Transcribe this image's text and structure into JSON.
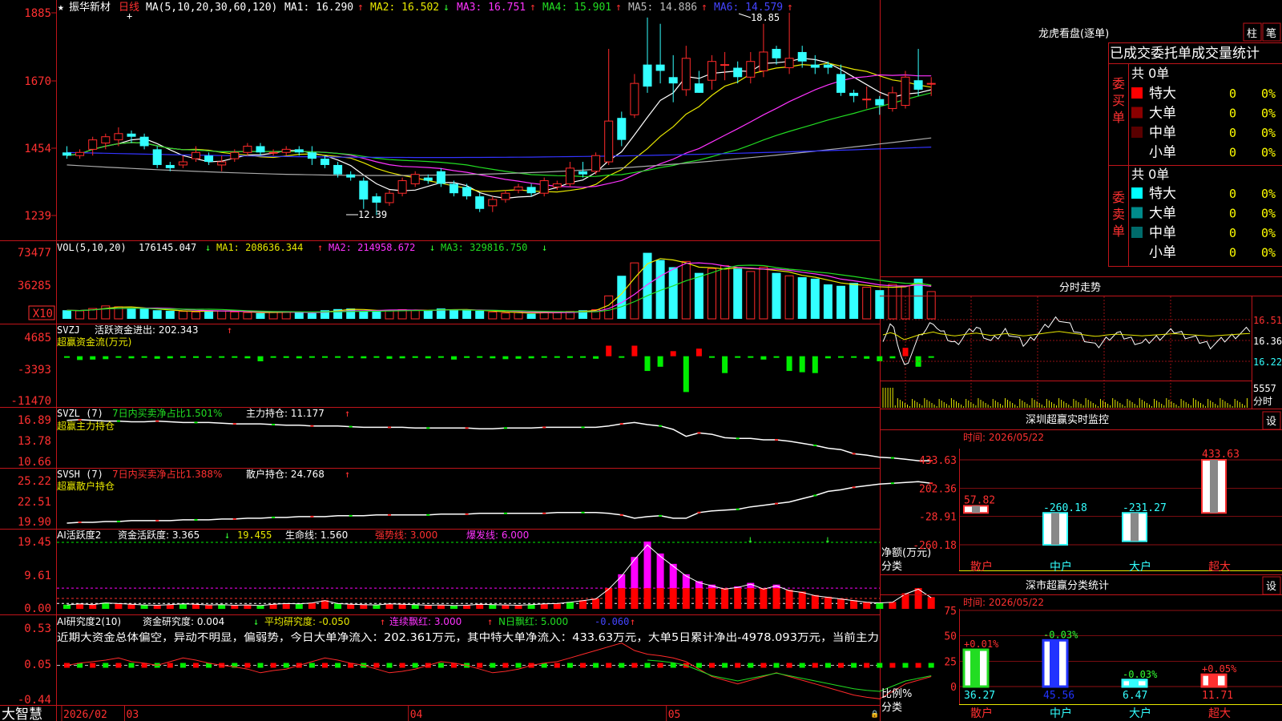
{
  "app": {
    "title": "大智慧",
    "date_label": "2026/02"
  },
  "stock": {
    "name": "振华新材",
    "period": "日线",
    "ma_params": "MA(5,10,20,30,60,120)"
  },
  "colors": {
    "up": "#ff2a2a",
    "down": "#33ffff",
    "bg": "#000000",
    "border": "#c0141a",
    "ma1": "#ffffff",
    "ma2": "#e8e800",
    "ma3": "#ff33ff",
    "ma4": "#22dd22",
    "ma5": "#aaaaaa",
    "ma6": "#3333ff",
    "green_bar": "#00ee00",
    "magenta_bar": "#ff00ff"
  },
  "kline": {
    "axis_labels": [
      "1885",
      "1670",
      "1454",
      "1239"
    ],
    "legend": [
      {
        "text": "MA1: 16.290",
        "arrow": "↑"
      },
      {
        "text": "MA2: 16.502",
        "arrow": "↓"
      },
      {
        "text": "MA3: 16.751",
        "arrow": "↑"
      },
      {
        "text": "MA4: 15.901",
        "arrow": "↑"
      },
      {
        "text": "MA5: 14.886",
        "arrow": "↑"
      },
      {
        "text": "MA6: 14.579",
        "arrow": "↑"
      }
    ],
    "high_label": "18.85",
    "low_label": "12.39",
    "candles": [
      {
        "o": 14.4,
        "h": 14.6,
        "l": 14.2,
        "c": 14.3
      },
      {
        "o": 14.3,
        "h": 14.5,
        "l": 14.2,
        "c": 14.4
      },
      {
        "o": 14.5,
        "h": 14.9,
        "l": 14.3,
        "c": 14.8
      },
      {
        "o": 14.7,
        "h": 15.0,
        "l": 14.5,
        "c": 14.9
      },
      {
        "o": 14.8,
        "h": 15.2,
        "l": 14.6,
        "c": 15.0
      },
      {
        "o": 15.0,
        "h": 15.1,
        "l": 14.7,
        "c": 14.9
      },
      {
        "o": 14.9,
        "h": 15.0,
        "l": 14.5,
        "c": 14.6
      },
      {
        "o": 14.5,
        "h": 14.6,
        "l": 13.9,
        "c": 14.0
      },
      {
        "o": 14.0,
        "h": 14.1,
        "l": 13.8,
        "c": 13.9
      },
      {
        "o": 14.0,
        "h": 14.3,
        "l": 13.9,
        "c": 14.1
      },
      {
        "o": 14.2,
        "h": 14.6,
        "l": 14.1,
        "c": 14.4
      },
      {
        "o": 14.3,
        "h": 14.4,
        "l": 14.0,
        "c": 14.1
      },
      {
        "o": 14.0,
        "h": 14.3,
        "l": 13.8,
        "c": 14.1
      },
      {
        "o": 14.2,
        "h": 14.5,
        "l": 14.1,
        "c": 14.4
      },
      {
        "o": 14.4,
        "h": 14.7,
        "l": 14.3,
        "c": 14.6
      },
      {
        "o": 14.6,
        "h": 14.7,
        "l": 14.3,
        "c": 14.4
      },
      {
        "o": 14.4,
        "h": 14.5,
        "l": 14.3,
        "c": 14.4
      },
      {
        "o": 14.4,
        "h": 14.6,
        "l": 14.3,
        "c": 14.5
      },
      {
        "o": 14.5,
        "h": 14.6,
        "l": 14.3,
        "c": 14.4
      },
      {
        "o": 14.4,
        "h": 14.6,
        "l": 14.0,
        "c": 14.2
      },
      {
        "o": 14.2,
        "h": 14.3,
        "l": 13.9,
        "c": 14.0
      },
      {
        "o": 14.0,
        "h": 14.1,
        "l": 13.6,
        "c": 13.7
      },
      {
        "o": 13.7,
        "h": 13.8,
        "l": 13.5,
        "c": 13.6
      },
      {
        "o": 13.5,
        "h": 13.6,
        "l": 12.6,
        "c": 12.9
      },
      {
        "o": 13.0,
        "h": 13.1,
        "l": 12.4,
        "c": 12.8
      },
      {
        "o": 12.8,
        "h": 13.2,
        "l": 12.7,
        "c": 13.1
      },
      {
        "o": 13.1,
        "h": 13.6,
        "l": 13.0,
        "c": 13.5
      },
      {
        "o": 13.4,
        "h": 13.8,
        "l": 13.3,
        "c": 13.7
      },
      {
        "o": 13.6,
        "h": 13.7,
        "l": 13.4,
        "c": 13.5
      },
      {
        "o": 13.8,
        "h": 13.9,
        "l": 13.3,
        "c": 13.4
      },
      {
        "o": 13.4,
        "h": 13.5,
        "l": 13.0,
        "c": 13.1
      },
      {
        "o": 13.3,
        "h": 13.4,
        "l": 12.9,
        "c": 13.0
      },
      {
        "o": 13.0,
        "h": 13.1,
        "l": 12.5,
        "c": 12.6
      },
      {
        "o": 12.7,
        "h": 13.0,
        "l": 12.5,
        "c": 12.9
      },
      {
        "o": 12.9,
        "h": 13.2,
        "l": 12.8,
        "c": 13.1
      },
      {
        "o": 13.2,
        "h": 13.4,
        "l": 13.1,
        "c": 13.3
      },
      {
        "o": 13.3,
        "h": 13.4,
        "l": 13.0,
        "c": 13.1
      },
      {
        "o": 13.1,
        "h": 13.6,
        "l": 13.0,
        "c": 13.5
      },
      {
        "o": 13.3,
        "h": 13.5,
        "l": 13.2,
        "c": 13.4
      },
      {
        "o": 13.4,
        "h": 14.1,
        "l": 13.3,
        "c": 13.9
      },
      {
        "o": 13.8,
        "h": 14.1,
        "l": 13.6,
        "c": 13.7
      },
      {
        "o": 13.8,
        "h": 14.4,
        "l": 13.7,
        "c": 14.3
      },
      {
        "o": 14.1,
        "h": 17.7,
        "l": 14.0,
        "c": 15.4
      },
      {
        "o": 15.5,
        "h": 15.7,
        "l": 14.6,
        "c": 14.8
      },
      {
        "o": 15.6,
        "h": 16.9,
        "l": 15.5,
        "c": 16.6
      },
      {
        "o": 17.2,
        "h": 18.7,
        "l": 16.3,
        "c": 16.5
      },
      {
        "o": 17.2,
        "h": 18.5,
        "l": 16.6,
        "c": 17.0
      },
      {
        "o": 16.8,
        "h": 17.5,
        "l": 16.0,
        "c": 16.6
      },
      {
        "o": 16.4,
        "h": 17.8,
        "l": 16.2,
        "c": 17.4
      },
      {
        "o": 16.6,
        "h": 17.0,
        "l": 16.3,
        "c": 16.3
      },
      {
        "o": 16.7,
        "h": 17.5,
        "l": 16.4,
        "c": 17.3
      },
      {
        "o": 17.2,
        "h": 17.6,
        "l": 16.7,
        "c": 17.2
      },
      {
        "o": 17.1,
        "h": 17.3,
        "l": 16.6,
        "c": 16.8
      },
      {
        "o": 16.8,
        "h": 17.6,
        "l": 16.6,
        "c": 17.3
      },
      {
        "o": 17.0,
        "h": 18.5,
        "l": 16.8,
        "c": 17.6
      },
      {
        "o": 17.7,
        "h": 17.8,
        "l": 17.2,
        "c": 17.4
      },
      {
        "o": 17.1,
        "h": 18.85,
        "l": 16.9,
        "c": 17.4
      },
      {
        "o": 17.6,
        "h": 17.8,
        "l": 17.1,
        "c": 17.3
      },
      {
        "o": 17.2,
        "h": 17.5,
        "l": 16.9,
        "c": 17.1
      },
      {
        "o": 17.2,
        "h": 17.3,
        "l": 16.9,
        "c": 17.1
      },
      {
        "o": 16.9,
        "h": 17.2,
        "l": 16.2,
        "c": 16.3
      },
      {
        "o": 16.3,
        "h": 16.4,
        "l": 16.0,
        "c": 16.2
      },
      {
        "o": 16.1,
        "h": 16.5,
        "l": 15.8,
        "c": 16.1
      },
      {
        "o": 16.1,
        "h": 16.2,
        "l": 15.6,
        "c": 15.9
      },
      {
        "o": 15.8,
        "h": 16.5,
        "l": 15.7,
        "c": 16.3
      },
      {
        "o": 15.9,
        "h": 17.0,
        "l": 15.8,
        "c": 16.8
      },
      {
        "o": 16.7,
        "h": 17.7,
        "l": 16.2,
        "c": 16.4
      },
      {
        "o": 16.6,
        "h": 16.8,
        "l": 16.2,
        "c": 16.6
      }
    ]
  },
  "vol": {
    "axis_labels": [
      "73477",
      "36285",
      "X10"
    ],
    "legend": [
      {
        "text": "VOL(5,10,20)",
        "value": "176145.047",
        "arrow": "↓"
      },
      {
        "text": "MA1: 208636.344",
        "arrow": "↑"
      },
      {
        "text": "MA2: 214958.672",
        "arrow": "↓"
      },
      {
        "text": "MA3: 329816.750",
        "arrow": "↓"
      }
    ],
    "values": [
      30,
      28,
      36,
      45,
      42,
      38,
      35,
      30,
      28,
      26,
      24,
      30,
      28,
      24,
      22,
      20,
      25,
      24,
      22,
      20,
      30,
      34,
      36,
      28,
      26,
      30,
      32,
      30,
      28,
      36,
      32,
      30,
      28,
      24,
      20,
      22,
      18,
      24,
      22,
      26,
      30,
      32,
      80,
      150,
      195,
      230,
      205,
      180,
      200,
      160,
      175,
      185,
      175,
      165,
      180,
      160,
      150,
      145,
      140,
      120,
      115,
      125,
      110,
      100,
      120,
      115,
      140,
      95
    ]
  },
  "svzj": {
    "title": "SVZJ",
    "legend": "活跃资金进出: 202.343",
    "legend_arrow": "↑",
    "subtitle": "超赢资金流(万元)",
    "axis_labels": [
      "4685",
      "-3393",
      "-11470"
    ],
    "values": [
      -200,
      -900,
      -800,
      -700,
      -300,
      -500,
      -300,
      -600,
      -500,
      -200,
      -400,
      -300,
      -350,
      -300,
      -500,
      -1200,
      -300,
      -400,
      -500,
      -300,
      -350,
      -300,
      -400,
      -500,
      -300,
      -600,
      -500,
      -400,
      -500,
      -300,
      -800,
      -400,
      -300,
      -500,
      -700,
      -600,
      -500,
      -200,
      -300,
      -400,
      -300,
      -600,
      2500,
      -300,
      2500,
      -3500,
      -2500,
      1200,
      -8500,
      1800,
      -300,
      -4000,
      -200,
      -300,
      -800,
      -300,
      -3500,
      -3800,
      -4000,
      -500,
      -300,
      -200,
      -600,
      -1200,
      -500,
      2000,
      -2500,
      -200
    ]
  },
  "svzl": {
    "title": "SVZL (7)",
    "legend": "7日内买卖净占比1.501%",
    "legend2": "主力持仓: 11.177",
    "legend2_arrow": "↑",
    "subtitle": "超赢主力持仓",
    "axis_labels": [
      "16.89",
      "13.78",
      "10.66"
    ],
    "values": [
      16.8,
      16.9,
      16.8,
      16.7,
      16.7,
      16.6,
      16.6,
      16.7,
      16.6,
      16.5,
      16.5,
      16.5,
      16.4,
      16.3,
      16.3,
      16.3,
      16.2,
      16.1,
      16.1,
      16.0,
      16.0,
      16.0,
      15.9,
      15.8,
      15.8,
      15.8,
      15.8,
      15.7,
      15.7,
      15.7,
      15.7,
      15.7,
      15.6,
      15.6,
      15.7,
      15.7,
      15.7,
      15.8,
      15.8,
      15.8,
      15.8,
      15.8,
      16.0,
      16.3,
      16.5,
      16.2,
      16.0,
      15.5,
      14.5,
      15.0,
      14.8,
      14.3,
      14.2,
      14.2,
      14.0,
      14.0,
      13.8,
      13.5,
      13.2,
      12.8,
      12.6,
      12.0,
      11.8,
      11.5,
      11.4,
      11.2,
      11.0,
      11.0
    ]
  },
  "svsh": {
    "title": "SVSH (7)",
    "legend": "7日内买卖净占比1.388%",
    "legend2": "散户持仓: 24.768",
    "legend2_arrow": "↑",
    "subtitle": "超赢散户持仓",
    "axis_labels": [
      "25.22",
      "22.51",
      "19.90"
    ],
    "values": [
      20.0,
      20.1,
      20.1,
      20.2,
      20.2,
      20.3,
      20.3,
      20.3,
      20.3,
      20.4,
      20.4,
      20.4,
      20.5,
      20.5,
      20.6,
      20.6,
      20.7,
      20.7,
      20.8,
      20.8,
      20.8,
      20.9,
      20.9,
      20.9,
      21.0,
      21.0,
      21.0,
      21.0,
      21.0,
      21.1,
      21.1,
      21.1,
      21.2,
      21.2,
      21.2,
      21.2,
      21.2,
      21.2,
      21.3,
      21.3,
      21.3,
      21.3,
      21.2,
      21.0,
      20.6,
      20.8,
      20.9,
      20.6,
      20.6,
      21.3,
      21.5,
      21.6,
      21.7,
      22.0,
      22.2,
      22.4,
      22.6,
      23.0,
      23.4,
      23.9,
      24.1,
      24.4,
      24.6,
      24.8,
      24.9,
      25.0,
      25.1,
      24.9
    ]
  },
  "ai_activity": {
    "title": "AI活跃度2",
    "legend": "资金活跃度: 3.365",
    "legend_arrow": "↓",
    "legend_val2": "19.455",
    "lifeline": "生命线: 1.560",
    "strong": "强势线: 3.000",
    "burst": "爆发线: 6.000",
    "axis_labels": [
      "19.45",
      "9.61",
      "0.00"
    ],
    "values": [
      1.2,
      1.5,
      1.3,
      1.8,
      1.6,
      1.4,
      1.2,
      1.1,
      1.3,
      1.5,
      1.4,
      1.2,
      1.3,
      1.1,
      1.2,
      1.0,
      1.4,
      1.6,
      1.5,
      1.8,
      2.5,
      1.6,
      1.4,
      1.3,
      1.2,
      1.5,
      1.4,
      1.3,
      1.1,
      1.2,
      1.0,
      1.1,
      1.4,
      1.3,
      1.2,
      1.1,
      1.3,
      1.5,
      1.6,
      2.0,
      2.5,
      3.0,
      6.0,
      10.0,
      15.0,
      19.45,
      16.0,
      13.0,
      10.0,
      8.0,
      7.0,
      6.0,
      6.5,
      7.5,
      6.0,
      7.0,
      5.5,
      5.0,
      4.0,
      3.5,
      3.0,
      2.5,
      2.0,
      1.8,
      2.0,
      4.5,
      6.0,
      3.4
    ]
  },
  "ai_research": {
    "title": "AI研究度2(10)",
    "legend": "资金研究度: 0.004",
    "legend_arrow": "↓",
    "avg": "平均研究度: -0.050",
    "avg_arrow": "↑",
    "red": "连续飘红: 3.000",
    "red_arrow": "↑",
    "nred": "N日飘红: 5.000",
    "extra": "-0.060",
    "extra_arrow": "↑",
    "summary": "近期大资金总体偏空，异动不明显，偏弱势，今日大单净流入：202.361万元，其中特大单净流入：433.63万元，大单5日累计净出-4978.093万元，当前主力",
    "axis_labels": [
      "0.53",
      "0.05",
      "-0.44"
    ],
    "values": [
      0.05,
      0.08,
      0.1,
      0.12,
      0.15,
      0.1,
      0.08,
      0.05,
      0.1,
      0.15,
      0.12,
      0.08,
      0.05,
      0.03,
      0.0,
      -0.05,
      -0.02,
      0.0,
      0.05,
      0.1,
      0.15,
      0.12,
      0.08,
      0.05,
      0.0,
      -0.05,
      -0.03,
      0.0,
      0.05,
      0.1,
      0.08,
      0.05,
      0.0,
      -0.05,
      -0.03,
      0.0,
      0.05,
      0.08,
      0.1,
      0.15,
      0.2,
      0.25,
      0.3,
      0.35,
      0.25,
      0.2,
      0.18,
      0.15,
      0.1,
      0.0,
      -0.1,
      -0.15,
      -0.2,
      -0.15,
      -0.1,
      -0.05,
      -0.1,
      -0.15,
      -0.2,
      -0.25,
      -0.3,
      -0.35,
      -0.38,
      -0.4,
      -0.3,
      -0.2,
      -0.15,
      -0.1
    ]
  },
  "xaxis": {
    "labels": [
      "2026/02",
      "03",
      "04",
      "05"
    ],
    "tick_index": [
      0,
      5,
      27,
      47
    ]
  },
  "right": {
    "dragon_title": "龙虎看盘(逐单)",
    "btn_bar": "柱",
    "btn_tick": "笔",
    "dragon_header": "已成交委托单成交量统计",
    "buy_total": "共 0单",
    "sell_total": "共 0单",
    "buy_label": "委买单",
    "sell_label": "委卖单",
    "buy_rows": [
      {
        "name": "特大",
        "count": "0",
        "pct": "0%",
        "color": "#ff0000"
      },
      {
        "name": "大单",
        "count": "0",
        "pct": "0%",
        "color": "#8b0000"
      },
      {
        "name": "中单",
        "count": "0",
        "pct": "0%",
        "color": "#5a0000"
      },
      {
        "name": "小单",
        "count": "0",
        "pct": "0%",
        "color": "#000000"
      }
    ],
    "sell_rows": [
      {
        "name": "特大",
        "count": "0",
        "pct": "0%",
        "color": "#00ffff"
      },
      {
        "name": "大单",
        "count": "0",
        "pct": "0%",
        "color": "#008b8b"
      },
      {
        "name": "中单",
        "count": "0",
        "pct": "0%",
        "color": "#006b6b"
      },
      {
        "name": "小单",
        "count": "0",
        "pct": "0%",
        "color": "#000000"
      }
    ],
    "intraday_title": "分时走势",
    "intraday_labels": [
      "16.51",
      "16.36",
      "16.22",
      "5557",
      "分时"
    ],
    "monitor_title": "深圳超赢实时监控",
    "monitor_btn": "设",
    "monitor_time": "时间: 2026/05/22",
    "monitor_axis": [
      "433.63",
      "202.36",
      "-28.91",
      "-260.18"
    ],
    "monitor_ylabel": "净额(万元)",
    "monitor_xlabel": "分类",
    "monitor_bars": [
      {
        "name": "散户",
        "value": 57.82,
        "label": "57.82"
      },
      {
        "name": "中户",
        "value": -260.18,
        "label": "-260.18"
      },
      {
        "name": "大户",
        "value": -231.27,
        "label": "-231.27"
      },
      {
        "name": "超大",
        "value": 433.63,
        "label": "433.63"
      }
    ],
    "class_title": "深市超赢分类统计",
    "class_btn": "设",
    "class_time": "时间: 2026/05/22",
    "class_axis": [
      "75",
      "50",
      "25",
      "0"
    ],
    "class_ylabel": "比例%",
    "class_xlabel": "分类",
    "class_bars": [
      {
        "name": "散户",
        "value": 36.27,
        "label": "36.27",
        "delta": "+0.01%"
      },
      {
        "name": "中户",
        "value": 45.56,
        "label": "45.56",
        "delta": "-0.03%"
      },
      {
        "name": "大户",
        "value": 6.47,
        "label": "6.47",
        "delta": "-0.03%"
      },
      {
        "name": "超大",
        "value": 11.71,
        "label": "11.71",
        "delta": "+0.05%"
      }
    ]
  }
}
